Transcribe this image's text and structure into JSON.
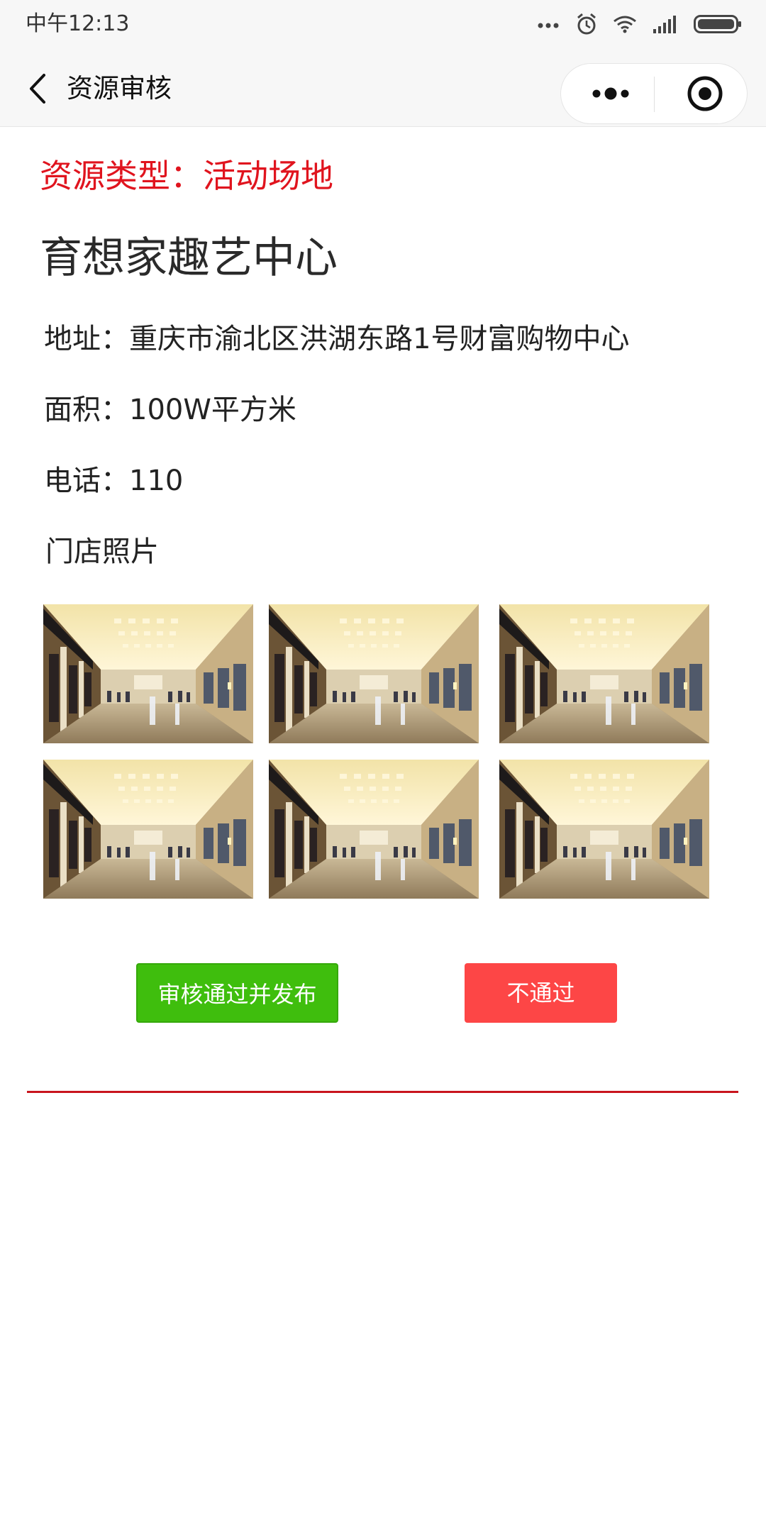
{
  "status_bar": {
    "time": "中午12:13"
  },
  "nav": {
    "title": "资源审核",
    "back_icon": "chevron-left-icon",
    "more_icon": "more-dots-icon",
    "close_icon": "target-close-icon"
  },
  "resource": {
    "type_line": "资源类型：活动场地",
    "name": "育想家趣艺中心",
    "address_line": "地址：重庆市渝北区洪湖东路1号财富购物中心",
    "area_line": "面积：100W平方米",
    "phone_line": "电话：110",
    "photos_label": "门店照片",
    "photo_count": 6
  },
  "actions": {
    "approve_label": "审核通过并发布",
    "reject_label": "不通过"
  },
  "colors": {
    "type_text": "#e0141e",
    "approve_button": "#3fbe0d",
    "reject_button": "#fd4646",
    "divider": "#c9151e"
  }
}
